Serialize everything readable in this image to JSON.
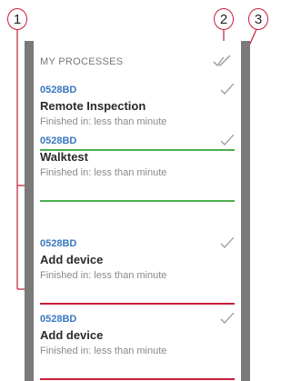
{
  "callouts": [
    "1",
    "2",
    "3"
  ],
  "header": {
    "title": "MY PROCESSES",
    "mark_all_icon": "double-check-icon"
  },
  "processes": [
    {
      "id": "0528BD",
      "name": "Remote Inspection",
      "status": "Finished in: less than minute",
      "result_color": "#4caf50",
      "check_icon": "check-icon"
    },
    {
      "id": "0528BD",
      "name": "Walktest",
      "status": "Finished in: less than minute",
      "result_color": "#4caf50",
      "check_icon": "check-icon"
    },
    {
      "id": "0528BD",
      "name": "Add device",
      "status": "Finished in: less than minute",
      "result_color": "#c81d3a",
      "check_icon": "check-icon"
    },
    {
      "id": "0528BD",
      "name": "Add device",
      "status": "Finished in: less than minute",
      "result_color": "#c81d3a",
      "check_icon": "check-icon"
    }
  ],
  "colors": {
    "callout": "#c81d3a",
    "panel_border": "#7a7a7a",
    "id_text": "#3a78c0"
  }
}
